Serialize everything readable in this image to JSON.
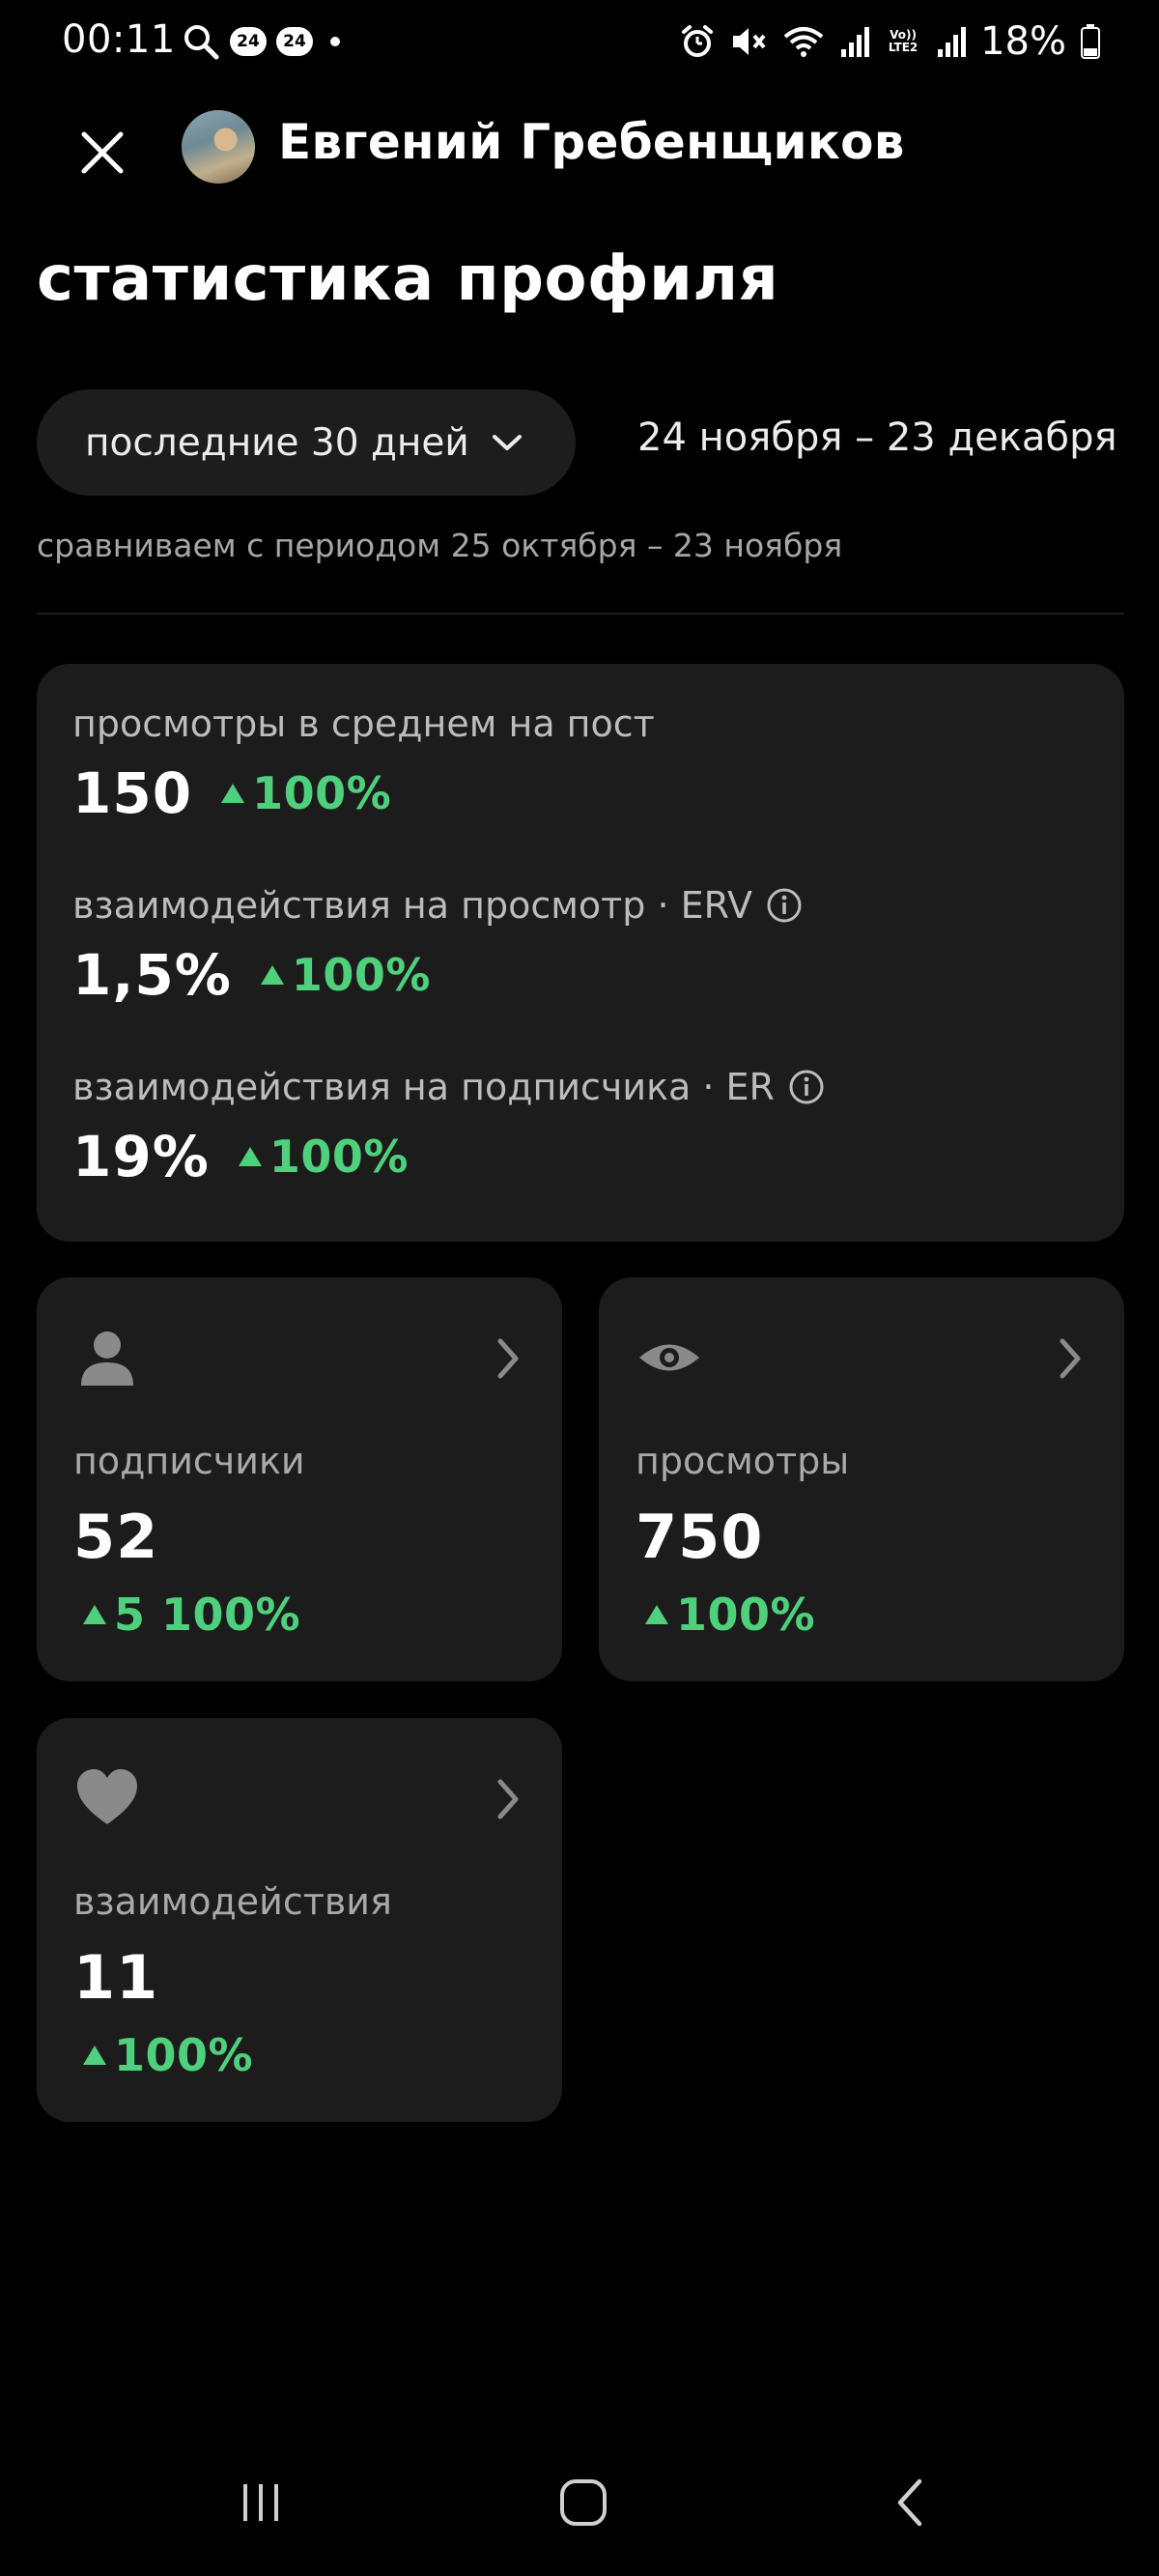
{
  "status_bar": {
    "time": "00:11",
    "badge_1": "24",
    "badge_2": "24",
    "network_label": "Vo)) LTE2",
    "battery": "18%"
  },
  "header": {
    "profile_name": "Евгений Гребенщиков"
  },
  "page": {
    "title": "статистика профиля",
    "period_label": "последние 30 дней",
    "date_range": "24 ноября – 23 декабря",
    "compare_text": "сравниваем с периодом 25 октября – 23 ноября"
  },
  "summary": {
    "metrics": [
      {
        "label": "просмотры в среднем на пост",
        "value": "150",
        "delta": "100%"
      },
      {
        "label": "взаимодействия на просмотр · ERV",
        "value": "1,5%",
        "delta": "100%"
      },
      {
        "label": "взаимодействия на подписчика · ER",
        "value": "19%",
        "delta": "100%"
      }
    ]
  },
  "tiles": {
    "followers": {
      "label": "подписчики",
      "value": "52",
      "delta": "5 100%"
    },
    "views": {
      "label": "просмотры",
      "value": "750",
      "delta": "100%"
    },
    "interactions": {
      "label": "взаимодействия",
      "value": "11",
      "delta": "100%"
    }
  },
  "colors": {
    "background": "#000000",
    "card": "#1c1c1c",
    "positive": "#4fd07c",
    "muted_text": "#a9a9a9"
  },
  "icons": {
    "close": "close-icon",
    "followers": "person-icon",
    "views": "eye-icon",
    "interactions": "heart-icon",
    "info": "info-icon",
    "chevron": "chevron-right-icon"
  }
}
